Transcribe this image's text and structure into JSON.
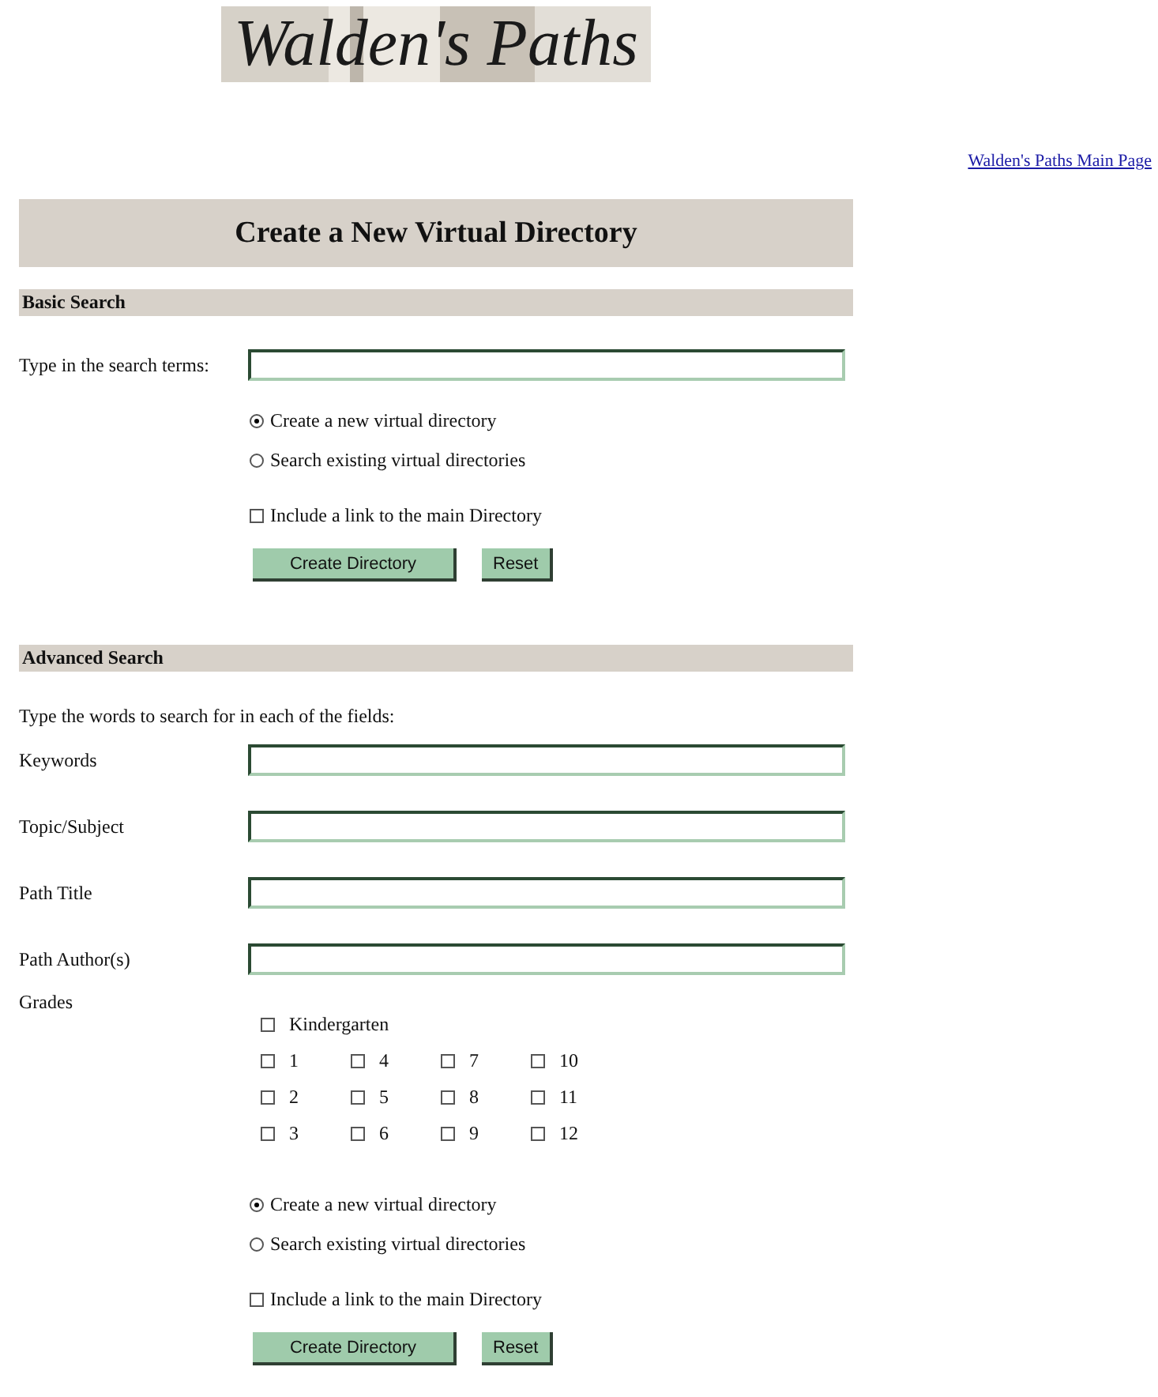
{
  "logo": {
    "text": "Walden's Paths"
  },
  "main_link": "Walden's Paths Main Page",
  "title": "Create a New Virtual Directory",
  "basic_search": {
    "heading": "Basic Search",
    "search_label": "Type in the search terms:",
    "mode_options": [
      {
        "label": "Create a new virtual directory",
        "selected": true
      },
      {
        "label": "Search existing virtual directories",
        "selected": false
      }
    ],
    "include_link": {
      "label": "Include a link to the main Directory",
      "checked": false
    },
    "buttons": [
      {
        "label": "Create Directory",
        "kind": "submit"
      },
      {
        "label": "Reset",
        "kind": "reset"
      }
    ]
  },
  "advanced_search": {
    "heading": "Advanced Search",
    "instructions": "Type the words to search for in each of the fields:",
    "fields": [
      {
        "label": "Keywords"
      },
      {
        "label": "Topic/Subject"
      },
      {
        "label": "Path Title"
      },
      {
        "label": "Path Author(s)"
      }
    ],
    "grades": {
      "label": "Grades",
      "kindergarten": {
        "label": "Kindergarten",
        "checked": false
      },
      "columns": [
        [
          {
            "label": "1",
            "checked": false
          },
          {
            "label": "2",
            "checked": false
          },
          {
            "label": "3",
            "checked": false
          }
        ],
        [
          {
            "label": "4",
            "checked": false
          },
          {
            "label": "5",
            "checked": false
          },
          {
            "label": "6",
            "checked": false
          }
        ],
        [
          {
            "label": "7",
            "checked": false
          },
          {
            "label": "8",
            "checked": false
          },
          {
            "label": "9",
            "checked": false
          }
        ],
        [
          {
            "label": "10",
            "checked": false
          },
          {
            "label": "11",
            "checked": false
          },
          {
            "label": "12",
            "checked": false
          }
        ]
      ]
    },
    "mode_options": [
      {
        "label": "Create a new virtual directory",
        "selected": true
      },
      {
        "label": "Search existing virtual directories",
        "selected": false
      }
    ],
    "include_link": {
      "label": "Include a link to the main Directory",
      "checked": false
    },
    "buttons": [
      {
        "label": "Create Directory",
        "kind": "submit"
      },
      {
        "label": "Reset",
        "kind": "reset"
      }
    ]
  }
}
